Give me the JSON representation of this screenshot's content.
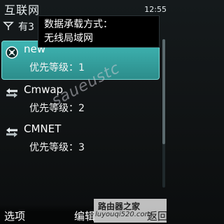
{
  "header": {
    "title": "互联网",
    "clock": "12:55"
  },
  "summary": {
    "count_text": "有3"
  },
  "tooltip": {
    "line1": "数据承载方式：",
    "line2": "无线局域网"
  },
  "destinations": [
    {
      "name": "new",
      "priority": "优先等级：1",
      "icon": "wifi-globe-icon"
    },
    {
      "name": "Cmwap",
      "priority": "优先等级：2",
      "icon": "arrows-icon"
    },
    {
      "name": "CMNET",
      "priority": "优先等级：3",
      "icon": "arrows-icon"
    }
  ],
  "softkeys": {
    "left": "选项",
    "middle": "编辑",
    "right": "返回"
  },
  "watermark": {
    "text": "saueustc",
    "site_name": "路由器之家",
    "site_url": "luyouqi520.com"
  },
  "colors": {
    "highlight": "#34a3a1",
    "background": "#121617"
  }
}
